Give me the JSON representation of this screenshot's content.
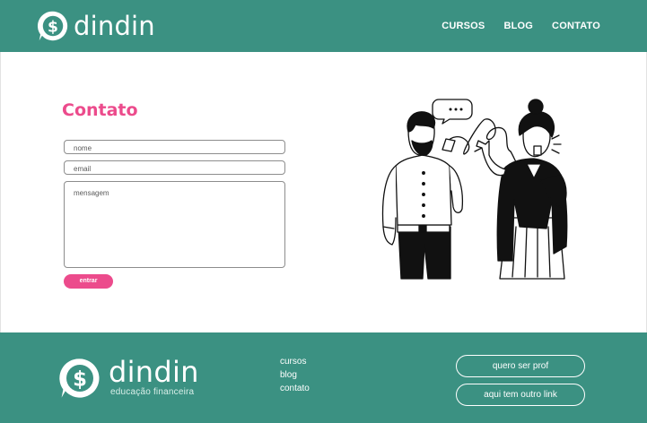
{
  "header": {
    "brand": "dindin",
    "logo_icon": "dollar-speech-bubble-icon",
    "nav": [
      {
        "label": "CURSOS"
      },
      {
        "label": "BLOG"
      },
      {
        "label": "CONTATO"
      }
    ]
  },
  "contact": {
    "title": "Contato",
    "fields": {
      "nome": {
        "placeholder": "nome",
        "value": ""
      },
      "email": {
        "placeholder": "email",
        "value": ""
      },
      "mensagem": {
        "placeholder": "mensagem",
        "value": ""
      }
    },
    "submit_label": "entrar",
    "illustration": "two-people-tin-can-phone-illustration"
  },
  "footer": {
    "brand": "dindin",
    "tagline": "educação financeira",
    "links": [
      {
        "label": "cursos"
      },
      {
        "label": "blog"
      },
      {
        "label": "contato"
      }
    ],
    "buttons": [
      {
        "label": "quero ser prof"
      },
      {
        "label": "aqui tem outro link"
      }
    ]
  },
  "colors": {
    "brand_green": "#3b9182",
    "accent_pink": "#ec4b8c",
    "white": "#ffffff"
  }
}
